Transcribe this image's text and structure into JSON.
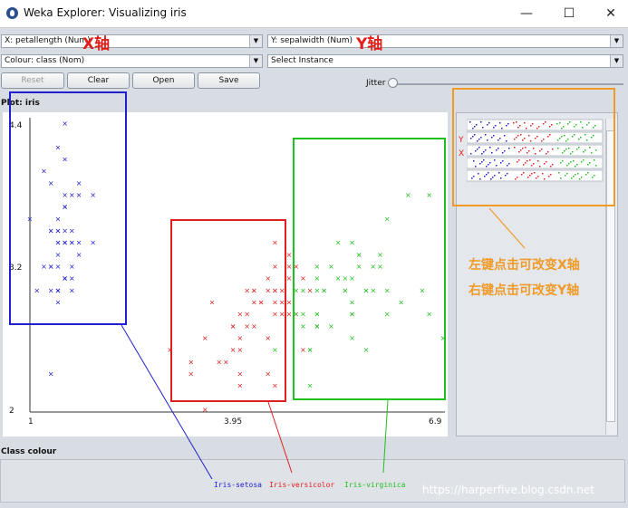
{
  "window": {
    "title": "Weka Explorer: Visualizing iris",
    "minimize": "—",
    "maximize": "☐",
    "close": "✕"
  },
  "controls": {
    "x_axis": "X: petallength (Num)",
    "y_axis": "Y: sepalwidth (Num)",
    "colour": "Colour: class (Nom)",
    "select_instance": "Select Instance",
    "reset": "Reset",
    "clear": "Clear",
    "open": "Open",
    "save": "Save",
    "jitter": "Jitter",
    "jitter_value": 0
  },
  "annotations": {
    "x_axis": "X轴",
    "y_axis": "Y轴",
    "left_click": "左键点击可改变X轴",
    "right_click": "右键点击可改变Y轴",
    "y_marker": "Y",
    "x_marker": "X",
    "watermark": "https://harperfive.blog.csdn.net"
  },
  "plot": {
    "label": "Plot: iris",
    "class_colour_label": "Class colour"
  },
  "colors": {
    "setosa": "#2020d0",
    "versicolor": "#e02020",
    "virginica": "#20c020",
    "orange": "#f09a27"
  },
  "chart_data": {
    "type": "scatter",
    "title": "",
    "xlabel": "",
    "ylabel": "",
    "xlim": [
      1,
      6.9
    ],
    "ylim": [
      2,
      4.4
    ],
    "x_ticks": [
      "1",
      "3.95",
      "6.9"
    ],
    "y_ticks": [
      "4.4",
      "3.2",
      "2"
    ],
    "marker": "×",
    "series": [
      {
        "name": "Iris-setosa",
        "color": "#2020d0",
        "points": [
          [
            1.4,
            3.5
          ],
          [
            1.4,
            3.0
          ],
          [
            1.3,
            3.2
          ],
          [
            1.5,
            3.1
          ],
          [
            1.4,
            3.6
          ],
          [
            1.7,
            3.9
          ],
          [
            1.4,
            3.4
          ],
          [
            1.5,
            3.4
          ],
          [
            1.4,
            2.9
          ],
          [
            1.5,
            3.1
          ],
          [
            1.5,
            3.7
          ],
          [
            1.6,
            3.4
          ],
          [
            1.4,
            3.0
          ],
          [
            1.1,
            3.0
          ],
          [
            1.2,
            4.0
          ],
          [
            1.5,
            4.4
          ],
          [
            1.3,
            3.9
          ],
          [
            1.4,
            3.5
          ],
          [
            1.7,
            3.8
          ],
          [
            1.5,
            3.8
          ],
          [
            1.7,
            3.4
          ],
          [
            1.5,
            3.7
          ],
          [
            1.0,
            3.6
          ],
          [
            1.7,
            3.3
          ],
          [
            1.9,
            3.4
          ],
          [
            1.6,
            3.0
          ],
          [
            1.6,
            3.4
          ],
          [
            1.5,
            3.5
          ],
          [
            1.4,
            3.4
          ],
          [
            1.6,
            3.2
          ],
          [
            1.6,
            3.1
          ],
          [
            1.5,
            3.4
          ],
          [
            1.5,
            4.1
          ],
          [
            1.4,
            4.2
          ],
          [
            1.5,
            3.1
          ],
          [
            1.2,
            3.2
          ],
          [
            1.3,
            3.5
          ],
          [
            1.5,
            3.1
          ],
          [
            1.3,
            3.0
          ],
          [
            1.5,
            3.4
          ],
          [
            1.3,
            3.5
          ],
          [
            1.3,
            2.3
          ],
          [
            1.3,
            3.2
          ],
          [
            1.6,
            3.5
          ],
          [
            1.9,
            3.8
          ],
          [
            1.4,
            3.0
          ],
          [
            1.6,
            3.8
          ],
          [
            1.4,
            3.2
          ],
          [
            1.5,
            3.7
          ],
          [
            1.4,
            3.3
          ]
        ]
      },
      {
        "name": "Iris-versicolor",
        "color": "#e02020",
        "points": [
          [
            4.7,
            3.2
          ],
          [
            4.5,
            3.2
          ],
          [
            4.9,
            3.1
          ],
          [
            4.0,
            2.3
          ],
          [
            4.6,
            2.8
          ],
          [
            4.5,
            2.8
          ],
          [
            4.7,
            3.3
          ],
          [
            3.3,
            2.4
          ],
          [
            4.6,
            2.9
          ],
          [
            3.9,
            2.7
          ],
          [
            3.5,
            2.0
          ],
          [
            4.2,
            3.0
          ],
          [
            4.0,
            2.2
          ],
          [
            4.7,
            2.9
          ],
          [
            3.6,
            2.9
          ],
          [
            4.4,
            3.1
          ],
          [
            4.5,
            3.0
          ],
          [
            4.1,
            2.7
          ],
          [
            4.5,
            2.2
          ],
          [
            3.9,
            2.5
          ],
          [
            4.8,
            3.2
          ],
          [
            4.0,
            2.8
          ],
          [
            4.9,
            2.5
          ],
          [
            4.7,
            2.8
          ],
          [
            4.3,
            2.9
          ],
          [
            4.4,
            3.0
          ],
          [
            4.8,
            2.8
          ],
          [
            5.0,
            3.0
          ],
          [
            4.5,
            2.9
          ],
          [
            3.5,
            2.6
          ],
          [
            3.8,
            2.4
          ],
          [
            3.7,
            2.4
          ],
          [
            3.9,
            2.7
          ],
          [
            5.1,
            2.7
          ],
          [
            4.5,
            3.0
          ],
          [
            4.5,
            3.4
          ],
          [
            4.7,
            3.1
          ],
          [
            4.4,
            2.3
          ],
          [
            4.1,
            3.0
          ],
          [
            4.0,
            2.5
          ],
          [
            4.4,
            2.6
          ],
          [
            4.6,
            3.0
          ],
          [
            4.0,
            2.6
          ],
          [
            3.3,
            2.3
          ],
          [
            4.2,
            2.7
          ],
          [
            4.2,
            3.0
          ],
          [
            4.2,
            2.9
          ],
          [
            4.3,
            2.9
          ],
          [
            3.0,
            2.5
          ],
          [
            4.1,
            2.8
          ]
        ]
      },
      {
        "name": "Iris-virginica",
        "color": "#20c020",
        "points": [
          [
            6.0,
            3.3
          ],
          [
            5.1,
            2.7
          ],
          [
            5.9,
            3.0
          ],
          [
            5.6,
            2.9
          ],
          [
            5.8,
            3.0
          ],
          [
            6.6,
            3.0
          ],
          [
            4.5,
            2.5
          ],
          [
            6.3,
            2.9
          ],
          [
            5.8,
            2.5
          ],
          [
            6.1,
            3.6
          ],
          [
            5.1,
            3.2
          ],
          [
            5.3,
            2.7
          ],
          [
            5.5,
            3.0
          ],
          [
            5.0,
            2.5
          ],
          [
            5.1,
            2.8
          ],
          [
            5.3,
            3.2
          ],
          [
            5.5,
            3.0
          ],
          [
            6.7,
            3.8
          ],
          [
            6.9,
            2.6
          ],
          [
            5.0,
            2.2
          ],
          [
            5.7,
            3.2
          ],
          [
            4.9,
            2.8
          ],
          [
            6.7,
            2.8
          ],
          [
            4.9,
            2.7
          ],
          [
            5.7,
            3.3
          ],
          [
            6.0,
            3.2
          ],
          [
            4.8,
            2.8
          ],
          [
            4.9,
            3.0
          ],
          [
            5.6,
            2.8
          ],
          [
            5.8,
            3.0
          ],
          [
            6.1,
            2.8
          ],
          [
            6.4,
            3.8
          ],
          [
            5.6,
            2.8
          ],
          [
            5.1,
            2.8
          ],
          [
            5.6,
            2.6
          ],
          [
            6.1,
            3.0
          ],
          [
            5.6,
            3.4
          ],
          [
            5.5,
            3.1
          ],
          [
            4.8,
            3.0
          ],
          [
            5.4,
            3.1
          ],
          [
            5.6,
            3.1
          ],
          [
            5.1,
            3.1
          ],
          [
            5.1,
            2.7
          ],
          [
            5.9,
            3.2
          ],
          [
            5.7,
            3.3
          ],
          [
            5.2,
            3.0
          ],
          [
            5.0,
            2.5
          ],
          [
            5.2,
            3.0
          ],
          [
            5.4,
            3.4
          ],
          [
            5.1,
            3.0
          ]
        ]
      }
    ]
  }
}
